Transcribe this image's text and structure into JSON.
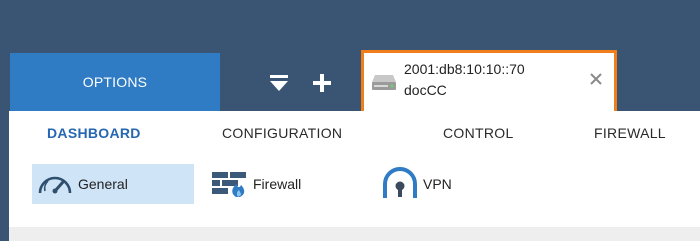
{
  "colors": {
    "header_bg": "#3a5574",
    "options_tab_bg": "#2f7bc4",
    "device_tab_border": "#f07f1b",
    "active_nav_text": "#2567b0",
    "active_subnav_bg": "#cfe4f7"
  },
  "header": {
    "options_tab_label": "OPTIONS",
    "controls": [
      {
        "icon": "filter-menu-icon"
      },
      {
        "icon": "plus-icon"
      }
    ],
    "device_tab": {
      "icon": "server-device-icon",
      "address": "2001:db8:10:10::70",
      "name": "docCC",
      "close_icon": "close-icon"
    }
  },
  "main_nav": {
    "items": [
      {
        "label": "DASHBOARD",
        "active": true
      },
      {
        "label": "CONFIGURATION",
        "active": false
      },
      {
        "label": "CONTROL",
        "active": false
      },
      {
        "label": "FIREWALL",
        "active": false
      }
    ]
  },
  "sub_nav": {
    "items": [
      {
        "label": "General",
        "icon": "gauge-icon",
        "active": true
      },
      {
        "label": "Firewall",
        "icon": "firewall-icon",
        "active": false
      },
      {
        "label": "VPN",
        "icon": "vpn-icon",
        "active": false
      }
    ]
  }
}
